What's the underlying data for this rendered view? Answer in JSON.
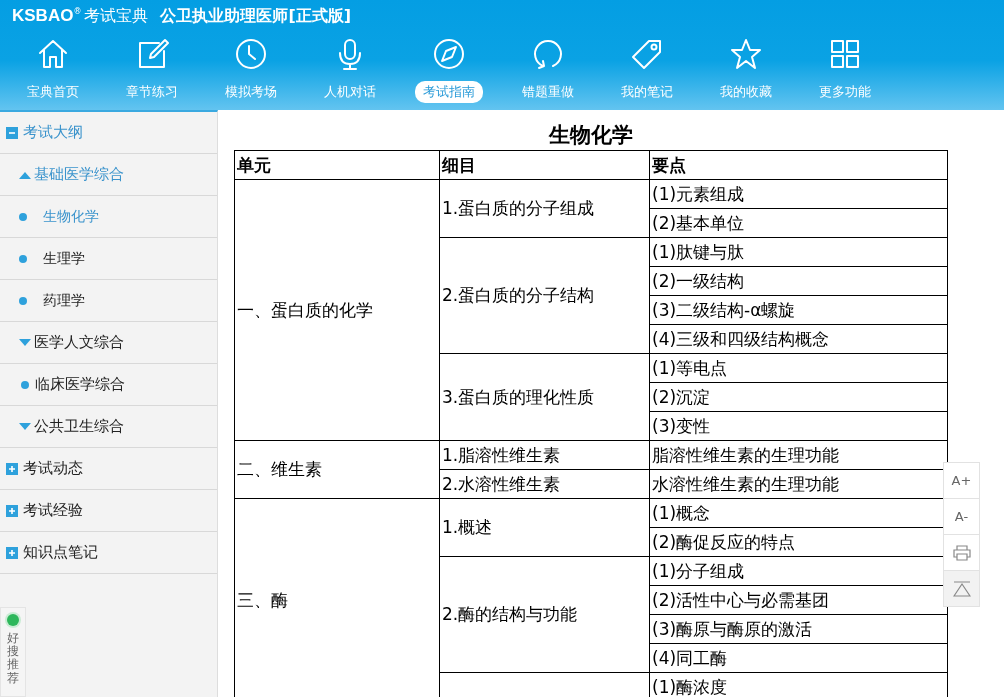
{
  "window": {
    "logo": "KSBAO",
    "logo_mark": "®",
    "brand": "考试宝典",
    "title": "公卫执业助理医师[正式版]"
  },
  "nav": [
    {
      "label": "宝典首页",
      "selected": false
    },
    {
      "label": "章节练习",
      "selected": false
    },
    {
      "label": "模拟考场",
      "selected": false
    },
    {
      "label": "人机对话",
      "selected": false
    },
    {
      "label": "考试指南",
      "selected": true
    },
    {
      "label": "错题重做",
      "selected": false
    },
    {
      "label": "我的笔记",
      "selected": false
    },
    {
      "label": "我的收藏",
      "selected": false
    },
    {
      "label": "更多功能",
      "selected": false
    }
  ],
  "sidebar": {
    "items": [
      {
        "label": "考试大纲",
        "kind": "section",
        "expanded": true,
        "children": [
          {
            "label": "基础医学综合",
            "kind": "group",
            "expanded": true,
            "children": [
              {
                "label": "生物化学",
                "kind": "leaf",
                "selected": true
              },
              {
                "label": "生理学",
                "kind": "leaf",
                "selected": false
              },
              {
                "label": "药理学",
                "kind": "leaf",
                "selected": false
              }
            ]
          },
          {
            "label": "医学人文综合",
            "kind": "group",
            "expanded": false
          },
          {
            "label": "临床医学综合",
            "kind": "item"
          },
          {
            "label": "公共卫生综合",
            "kind": "group",
            "expanded": false
          }
        ]
      },
      {
        "label": "考试动态",
        "kind": "section",
        "expanded": false
      },
      {
        "label": "考试经验",
        "kind": "section",
        "expanded": false
      },
      {
        "label": "知识点笔记",
        "kind": "section",
        "expanded": false
      }
    ],
    "recommend": "好搜推荐"
  },
  "content": {
    "title": "生物化学",
    "columns": [
      "单元",
      "细目",
      "要点"
    ],
    "units": [
      {
        "name": "一、蛋白质的化学",
        "items": [
          {
            "name": "1.蛋白质的分子组成",
            "points": [
              "(1)元素组成",
              "(2)基本单位"
            ]
          },
          {
            "name": "2.蛋白质的分子结构",
            "points": [
              "(1)肽键与肽",
              "(2)一级结构",
              "(3)二级结构-α螺旋",
              "(4)三级和四级结构概念"
            ]
          },
          {
            "name": "3.蛋白质的理化性质",
            "points": [
              "(1)等电点",
              "(2)沉淀",
              "(3)变性"
            ]
          }
        ]
      },
      {
        "name": "二、维生素",
        "items": [
          {
            "name": "1.脂溶性维生素",
            "points": [
              "脂溶性维生素的生理功能"
            ]
          },
          {
            "name": "2.水溶性维生素",
            "points": [
              "水溶性维生素的生理功能"
            ]
          }
        ]
      },
      {
        "name": "三、酶",
        "items": [
          {
            "name": "1.概述",
            "points": [
              "(1)概念",
              "(2)酶促反应的特点"
            ]
          },
          {
            "name": "2.酶的结构与功能",
            "points": [
              "(1)分子组成",
              "(2)活性中心与必需基团",
              "(3)酶原与酶原的激活",
              "(4)同工酶"
            ]
          },
          {
            "points": [
              "(1)酶浓度"
            ]
          }
        ]
      }
    ]
  },
  "tools": [
    "A+",
    "A-"
  ]
}
